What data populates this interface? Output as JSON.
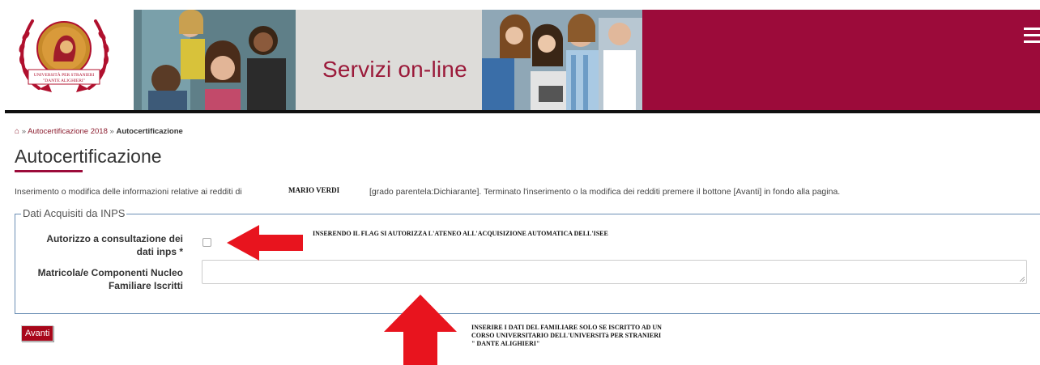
{
  "header": {
    "logo_text_line1": "UNIVERSITÀ PER STRANIERI",
    "logo_text_line2": "\"DANTE ALIGHIERI\"",
    "banner_title": "Servizi on-line",
    "menu_icon": "hamburger-menu-icon"
  },
  "breadcrumb": {
    "home_icon": "home-icon",
    "sep1": "»",
    "link": "Autocertificazione 2018",
    "sep2": "»",
    "current": "Autocertificazione"
  },
  "page": {
    "title": "Autocertificazione",
    "intro_prefix": "Inserimento o modifica delle informazioni relative ai redditi di",
    "intro_name": "MARIO VERDI",
    "intro_suffix": "[grado parentela:Dichiarante]. Terminato l'inserimento o la modifica dei redditi premere il bottone [Avanti] in fondo alla pagina."
  },
  "form": {
    "legend": "Dati Acquisiti da INPS",
    "autorizzo_label_line1": "Autorizzo a consultazione dei",
    "autorizzo_label_line2": "dati inps *",
    "autorizzo_checked": false,
    "matricola_label_line1": "Matricola/e Componenti Nucleo",
    "matricola_label_line2": "Familiare Iscritti",
    "matricola_value": ""
  },
  "notes": {
    "note1": "INSERENDO IL FLAG SI AUTORIZZA L'ATENEO ALL'ACQUISIZIONE AUTOMATICA DELL'ISEE",
    "note2_line1": "INSERIRE I DATI DEL FAMILIARE SOLO SE ISCRITTO AD UN",
    "note2_line2": "CORSO UNIVERSITARIO DELL'UNIVERSITà PER STRANIERI",
    "note2_line3": "\" DANTE ALIGHIERI\""
  },
  "actions": {
    "avanti_label": "Avanti"
  },
  "colors": {
    "brand_maroon": "#9c0b3a",
    "arrow_red": "#e8141e",
    "fieldset_border": "#6b8fb5"
  }
}
